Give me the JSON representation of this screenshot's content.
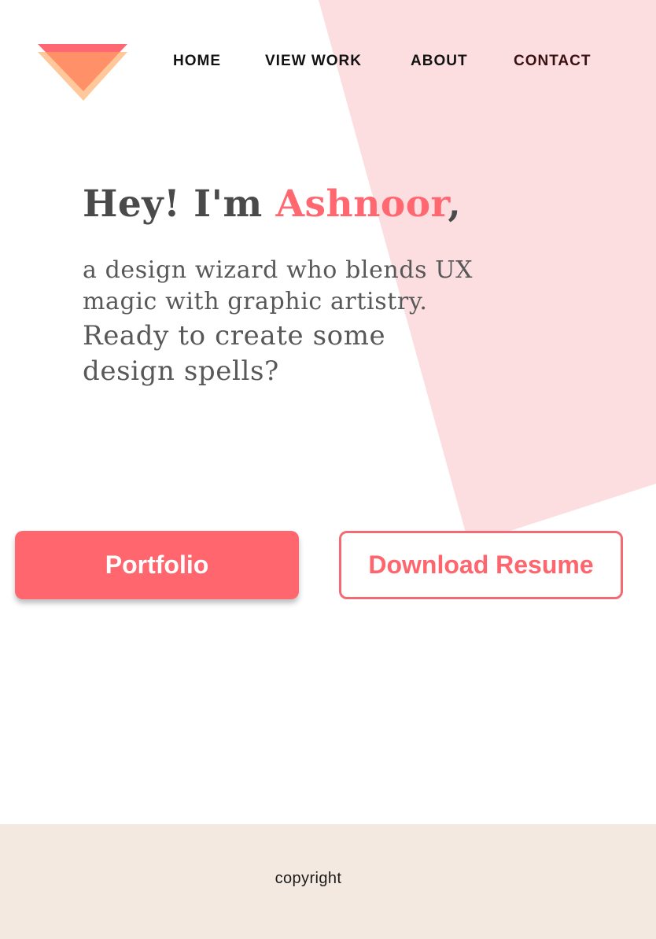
{
  "theme": {
    "accent": "#ff666d",
    "pink_background_shape": "#fcdee1",
    "footer_background": "#f4e9e0",
    "logo_colors": [
      "#ff6872",
      "#ff9068",
      "#ffc89a"
    ]
  },
  "header": {
    "logo_icon": "triangle-logo-icon",
    "nav": [
      {
        "label": "HOME"
      },
      {
        "label": "VIEW WORK"
      },
      {
        "label": "ABOUT"
      },
      {
        "label": "CONTACT"
      }
    ]
  },
  "hero": {
    "greeting": "Hey! I'm ",
    "name": "Ashnoor",
    "comma": ",",
    "tagline": "a design wizard who blends UX magic with graphic artistry.",
    "question": "Ready to create some design spells?"
  },
  "actions": {
    "portfolio_label": "Portfolio",
    "resume_label": "Download Resume"
  },
  "footer": {
    "text": "copyright"
  }
}
